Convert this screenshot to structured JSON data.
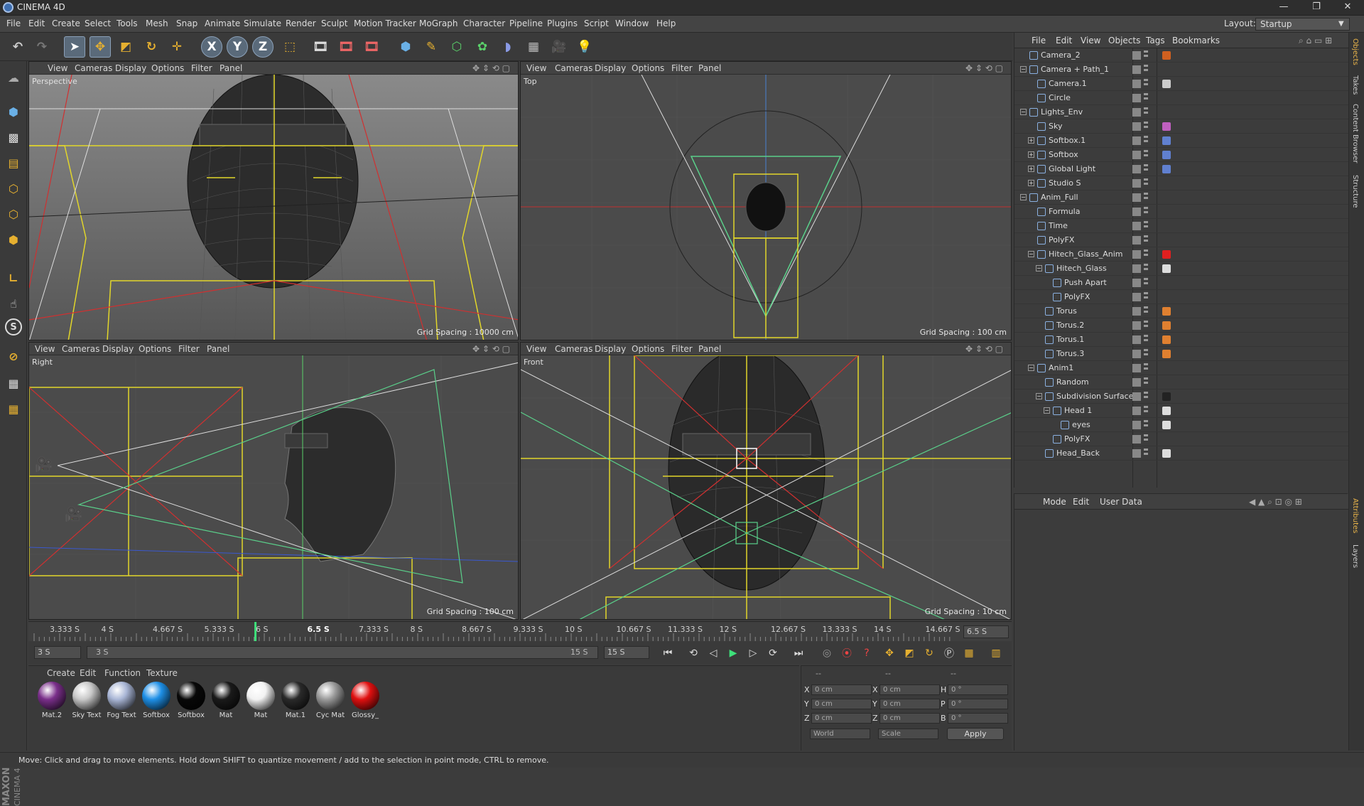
{
  "window": {
    "title": "CINEMA 4D",
    "controls": [
      "—",
      "❐",
      "✕"
    ]
  },
  "menu": [
    "File",
    "Edit",
    "Create",
    "Select",
    "Tools",
    "Mesh",
    "Snap",
    "Animate",
    "Simulate",
    "Render",
    "Sculpt",
    "Motion Tracker",
    "MoGraph",
    "Character",
    "Pipeline",
    "Plugins",
    "Script",
    "Window",
    "Help"
  ],
  "layout": {
    "label": "Layout:",
    "value": "Startup"
  },
  "viewport_menu": [
    "View",
    "Cameras",
    "Display",
    "Options",
    "Filter",
    "Panel"
  ],
  "viewports": [
    {
      "name": "Perspective",
      "grid": "Grid Spacing : 10000 cm"
    },
    {
      "name": "Top",
      "grid": "Grid Spacing : 100 cm"
    },
    {
      "name": "Right",
      "grid": "Grid Spacing : 100 cm"
    },
    {
      "name": "Front",
      "grid": "Grid Spacing : 10 cm"
    }
  ],
  "timeline": {
    "ticks": [
      "3.333 S",
      "4 S",
      "4.667 S",
      "5.333 S",
      "6 S",
      "6.5 S",
      "7.333 S",
      "8 S",
      "8.667 S",
      "9.333 S",
      "10 S",
      "10.667 S",
      "11.333 S",
      "12 S",
      "12.667 S",
      "13.333 S",
      "14 S",
      "14.667 S"
    ],
    "current": "6.5 S",
    "current_field": "6.5 S",
    "start": "3 S",
    "range_start": "3 S",
    "range_end": "15 S",
    "end": "15 S",
    "cursor_fraction": 0.24
  },
  "materials_menu": [
    "Create",
    "Edit",
    "Function",
    "Texture"
  ],
  "materials": [
    {
      "name": "Mat.2",
      "color": "#7a2f8a"
    },
    {
      "name": "Sky Text",
      "color": "#c8c8c8"
    },
    {
      "name": "Fog Text",
      "color": "#a9b6d6"
    },
    {
      "name": "Softbox",
      "color": "#1e8fe6"
    },
    {
      "name": "Softbox",
      "color": "#080808"
    },
    {
      "name": "Mat",
      "color": "#1a1a1a"
    },
    {
      "name": "Mat",
      "color": "#f2f2f2"
    },
    {
      "name": "Mat.1",
      "color": "#2a2a2a"
    },
    {
      "name": "Cyc Mat",
      "color": "#9a9a9a"
    },
    {
      "name": "Glossy_",
      "color": "#e01010"
    }
  ],
  "coords": {
    "header": [
      "--",
      "--",
      "--"
    ],
    "rows": [
      {
        "a": "X",
        "av": "0 cm",
        "b": "X",
        "bv": "0 cm",
        "c": "H",
        "cv": "0 °"
      },
      {
        "a": "Y",
        "av": "0 cm",
        "b": "Y",
        "bv": "0 cm",
        "c": "P",
        "cv": "0 °"
      },
      {
        "a": "Z",
        "av": "0 cm",
        "b": "Z",
        "bv": "0 cm",
        "c": "B",
        "cv": "0 °"
      }
    ],
    "world": "World",
    "scale": "Scale",
    "apply": "Apply"
  },
  "status": "Move: Click and drag to move elements. Hold down SHIFT to quantize movement / add to the selection in point mode, CTRL to remove.",
  "objects_menu": [
    "File",
    "Edit",
    "View",
    "Objects",
    "Tags",
    "Bookmarks"
  ],
  "objects": [
    {
      "name": "Camera_2",
      "indent": 0,
      "exp": "",
      "tag": "#d06020"
    },
    {
      "name": "Camera + Path_1",
      "indent": 0,
      "exp": "−",
      "tag": ""
    },
    {
      "name": "Camera.1",
      "indent": 1,
      "exp": "",
      "tag": "#cccccc"
    },
    {
      "name": "Circle",
      "indent": 1,
      "exp": "",
      "tag": ""
    },
    {
      "name": "Lights_Env",
      "indent": 0,
      "exp": "−",
      "tag": ""
    },
    {
      "name": "Sky",
      "indent": 1,
      "exp": "",
      "tag": "#c060c0"
    },
    {
      "name": "Softbox.1",
      "indent": 1,
      "exp": "+",
      "tag": "#6080d0"
    },
    {
      "name": "Softbox",
      "indent": 1,
      "exp": "+",
      "tag": "#6080d0"
    },
    {
      "name": "Global Light",
      "indent": 1,
      "exp": "+",
      "tag": "#6080d0"
    },
    {
      "name": "Studio S",
      "indent": 1,
      "exp": "+",
      "tag": ""
    },
    {
      "name": "Anim_Full",
      "indent": 0,
      "exp": "−",
      "tag": ""
    },
    {
      "name": "Formula",
      "indent": 1,
      "exp": "",
      "tag": ""
    },
    {
      "name": "Time",
      "indent": 1,
      "exp": "",
      "tag": ""
    },
    {
      "name": "PolyFX",
      "indent": 1,
      "exp": "",
      "tag": ""
    },
    {
      "name": "Hitech_Glass_Anim",
      "indent": 1,
      "exp": "−",
      "tag": "#e02020"
    },
    {
      "name": "Hitech_Glass",
      "indent": 2,
      "exp": "−",
      "tag": "#dddddd"
    },
    {
      "name": "Push Apart",
      "indent": 3,
      "exp": "",
      "tag": ""
    },
    {
      "name": "PolyFX",
      "indent": 3,
      "exp": "",
      "tag": ""
    },
    {
      "name": "Torus",
      "indent": 2,
      "exp": "",
      "tag": "#e08030"
    },
    {
      "name": "Torus.2",
      "indent": 2,
      "exp": "",
      "tag": "#e08030"
    },
    {
      "name": "Torus.1",
      "indent": 2,
      "exp": "",
      "tag": "#e08030"
    },
    {
      "name": "Torus.3",
      "indent": 2,
      "exp": "",
      "tag": "#e08030"
    },
    {
      "name": "Anim1",
      "indent": 1,
      "exp": "−",
      "tag": ""
    },
    {
      "name": "Random",
      "indent": 2,
      "exp": "",
      "tag": ""
    },
    {
      "name": "Subdivision Surface",
      "indent": 2,
      "exp": "−",
      "tag": "#222222"
    },
    {
      "name": "Head 1",
      "indent": 3,
      "exp": "−",
      "tag": "#dddddd"
    },
    {
      "name": "eyes",
      "indent": 4,
      "exp": "",
      "tag": "#dddddd"
    },
    {
      "name": "PolyFX",
      "indent": 3,
      "exp": "",
      "tag": ""
    },
    {
      "name": "Head_Back",
      "indent": 2,
      "exp": "",
      "tag": "#dddddd"
    }
  ],
  "attributes_menu": [
    "Mode",
    "Edit",
    "User Data"
  ],
  "right_tabs": [
    "Objects",
    "Takes",
    "Content Browser",
    "Structure",
    "Attributes",
    "Layers"
  ],
  "brand": {
    "top": "MAXON",
    "bottom": "CINEMA 4D"
  },
  "icons": {
    "undo": "undo-icon",
    "redo": "redo-icon",
    "select": "arrow-icon",
    "move": "move-icon",
    "scale": "scale-icon",
    "rotate": "rotate-icon",
    "x_axis": "X",
    "y_axis": "Y",
    "z_axis": "Z"
  }
}
